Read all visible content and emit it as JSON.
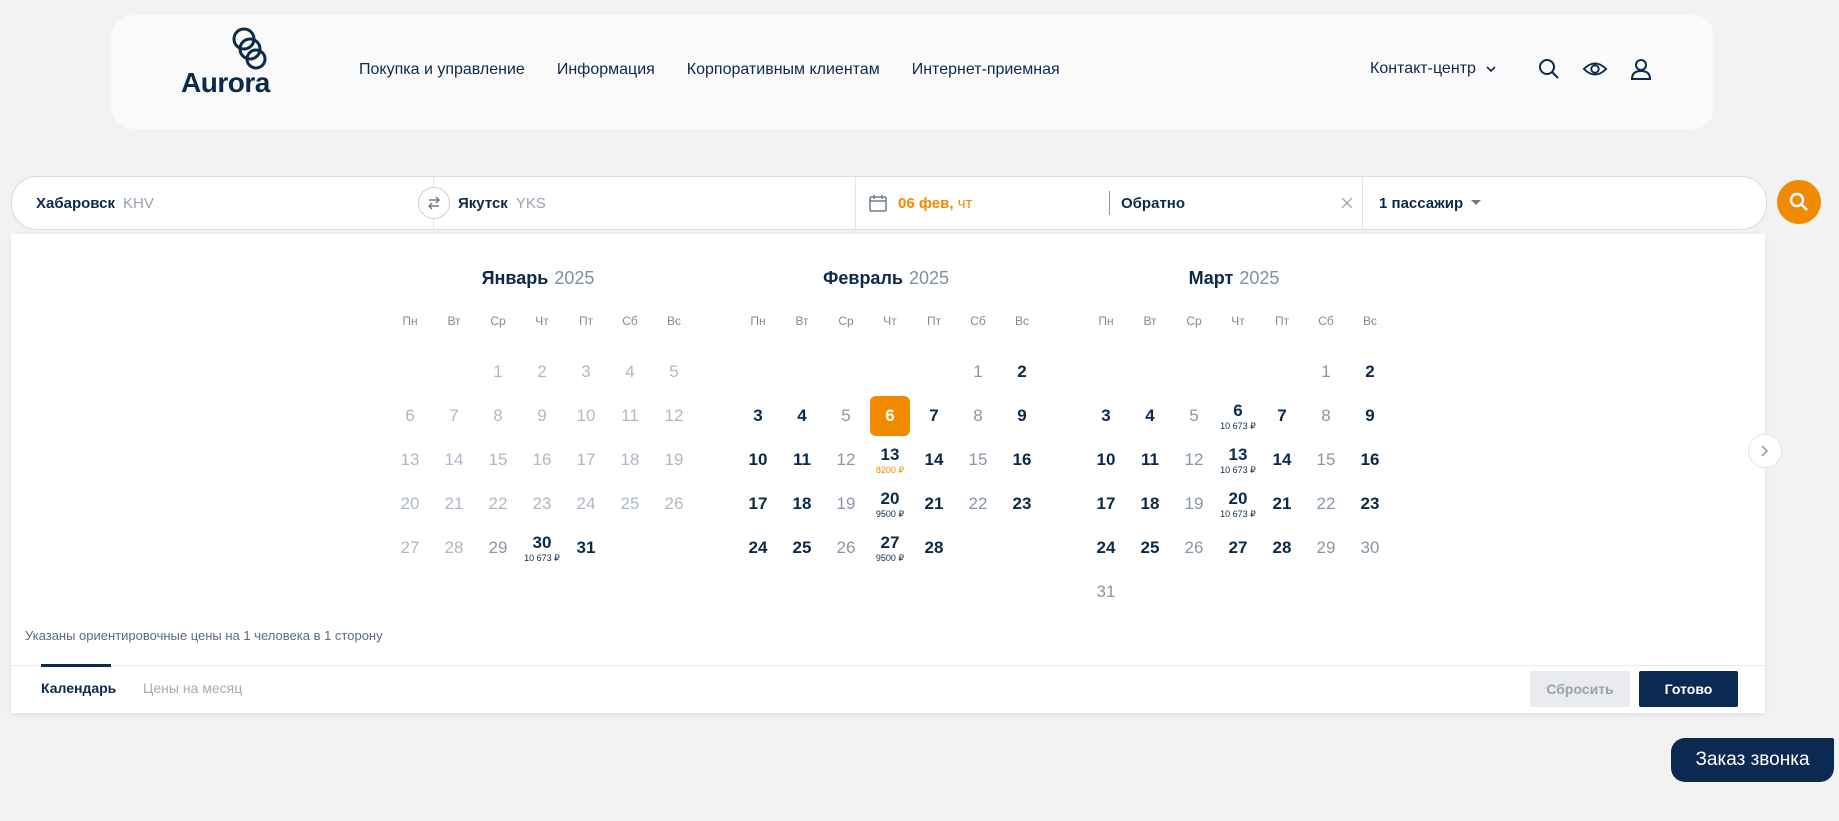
{
  "header": {
    "logo_text": "Aurora",
    "nav": [
      "Покупка и управление",
      "Информация",
      "Корпоративным клиентам",
      "Интернет-приемная"
    ],
    "contact_label": "Контакт-центр"
  },
  "search": {
    "from_city": "Хабаровск",
    "from_code": "KHV",
    "to_city": "Якутск",
    "to_code": "YKS",
    "depart_date": "06 фев,",
    "depart_weekday": "чт",
    "return_label": "Обратно",
    "passengers": "1 пассажир"
  },
  "calendar": {
    "weekdays": [
      "Пн",
      "Вт",
      "Ср",
      "Чт",
      "Пт",
      "Сб",
      "Вс"
    ],
    "months": [
      {
        "name": "Январь",
        "year": "2025",
        "offset": 2,
        "days": [
          {
            "d": "1",
            "s": "dis"
          },
          {
            "d": "2",
            "s": "dis"
          },
          {
            "d": "3",
            "s": "dis"
          },
          {
            "d": "4",
            "s": "dis"
          },
          {
            "d": "5",
            "s": "dis"
          },
          {
            "d": "6",
            "s": "dis"
          },
          {
            "d": "7",
            "s": "dis"
          },
          {
            "d": "8",
            "s": "dis"
          },
          {
            "d": "9",
            "s": "dis"
          },
          {
            "d": "10",
            "s": "dis"
          },
          {
            "d": "11",
            "s": "dis"
          },
          {
            "d": "12",
            "s": "dis"
          },
          {
            "d": "13",
            "s": "dis"
          },
          {
            "d": "14",
            "s": "dis"
          },
          {
            "d": "15",
            "s": "dis"
          },
          {
            "d": "16",
            "s": "dis"
          },
          {
            "d": "17",
            "s": "dis"
          },
          {
            "d": "18",
            "s": "dis"
          },
          {
            "d": "19",
            "s": "dis"
          },
          {
            "d": "20",
            "s": "dis"
          },
          {
            "d": "21",
            "s": "dis"
          },
          {
            "d": "22",
            "s": "dis"
          },
          {
            "d": "23",
            "s": "dis"
          },
          {
            "d": "24",
            "s": "dis"
          },
          {
            "d": "25",
            "s": "dis"
          },
          {
            "d": "26",
            "s": "dis"
          },
          {
            "d": "27",
            "s": "dis"
          },
          {
            "d": "28",
            "s": "dis"
          },
          {
            "d": "29",
            "s": "norm"
          },
          {
            "d": "30",
            "s": "avail",
            "p": "10 673 ₽"
          },
          {
            "d": "31",
            "s": "avail"
          }
        ]
      },
      {
        "name": "Февраль",
        "year": "2025",
        "offset": 5,
        "days": [
          {
            "d": "1",
            "s": "norm"
          },
          {
            "d": "2",
            "s": "avail"
          },
          {
            "d": "3",
            "s": "avail"
          },
          {
            "d": "4",
            "s": "avail"
          },
          {
            "d": "5",
            "s": "norm"
          },
          {
            "d": "6",
            "s": "sel"
          },
          {
            "d": "7",
            "s": "avail"
          },
          {
            "d": "8",
            "s": "norm"
          },
          {
            "d": "9",
            "s": "avail"
          },
          {
            "d": "10",
            "s": "avail"
          },
          {
            "d": "11",
            "s": "avail"
          },
          {
            "d": "12",
            "s": "norm"
          },
          {
            "d": "13",
            "s": "avail",
            "p": "8200 ₽",
            "po": true
          },
          {
            "d": "14",
            "s": "avail"
          },
          {
            "d": "15",
            "s": "norm"
          },
          {
            "d": "16",
            "s": "avail"
          },
          {
            "d": "17",
            "s": "avail"
          },
          {
            "d": "18",
            "s": "avail"
          },
          {
            "d": "19",
            "s": "norm"
          },
          {
            "d": "20",
            "s": "avail",
            "p": "9500 ₽"
          },
          {
            "d": "21",
            "s": "avail"
          },
          {
            "d": "22",
            "s": "norm"
          },
          {
            "d": "23",
            "s": "avail"
          },
          {
            "d": "24",
            "s": "avail"
          },
          {
            "d": "25",
            "s": "avail"
          },
          {
            "d": "26",
            "s": "norm"
          },
          {
            "d": "27",
            "s": "avail",
            "p": "9500 ₽"
          },
          {
            "d": "28",
            "s": "avail"
          }
        ]
      },
      {
        "name": "Март",
        "year": "2025",
        "offset": 5,
        "days": [
          {
            "d": "1",
            "s": "norm"
          },
          {
            "d": "2",
            "s": "avail"
          },
          {
            "d": "3",
            "s": "avail"
          },
          {
            "d": "4",
            "s": "avail"
          },
          {
            "d": "5",
            "s": "norm"
          },
          {
            "d": "6",
            "s": "avail",
            "p": "10 673 ₽"
          },
          {
            "d": "7",
            "s": "avail"
          },
          {
            "d": "8",
            "s": "norm"
          },
          {
            "d": "9",
            "s": "avail"
          },
          {
            "d": "10",
            "s": "avail"
          },
          {
            "d": "11",
            "s": "avail"
          },
          {
            "d": "12",
            "s": "norm"
          },
          {
            "d": "13",
            "s": "avail",
            "p": "10 673 ₽"
          },
          {
            "d": "14",
            "s": "avail"
          },
          {
            "d": "15",
            "s": "norm"
          },
          {
            "d": "16",
            "s": "avail"
          },
          {
            "d": "17",
            "s": "avail"
          },
          {
            "d": "18",
            "s": "avail"
          },
          {
            "d": "19",
            "s": "norm"
          },
          {
            "d": "20",
            "s": "avail",
            "p": "10 673 ₽"
          },
          {
            "d": "21",
            "s": "avail"
          },
          {
            "d": "22",
            "s": "norm"
          },
          {
            "d": "23",
            "s": "avail"
          },
          {
            "d": "24",
            "s": "avail"
          },
          {
            "d": "25",
            "s": "avail"
          },
          {
            "d": "26",
            "s": "norm"
          },
          {
            "d": "27",
            "s": "avail"
          },
          {
            "d": "28",
            "s": "avail"
          },
          {
            "d": "29",
            "s": "norm"
          },
          {
            "d": "30",
            "s": "norm"
          },
          {
            "d": "31",
            "s": "norm"
          }
        ]
      }
    ],
    "note": "Указаны ориентировочные цены на 1 человека в 1 сторону",
    "tab_calendar": "Календарь",
    "tab_prices": "Цены на месяц",
    "reset_label": "Сбросить",
    "done_label": "Готово"
  },
  "callback_label": "Заказ звонка",
  "colors": {
    "accent": "#f08a00",
    "brand": "#0b2a52"
  }
}
